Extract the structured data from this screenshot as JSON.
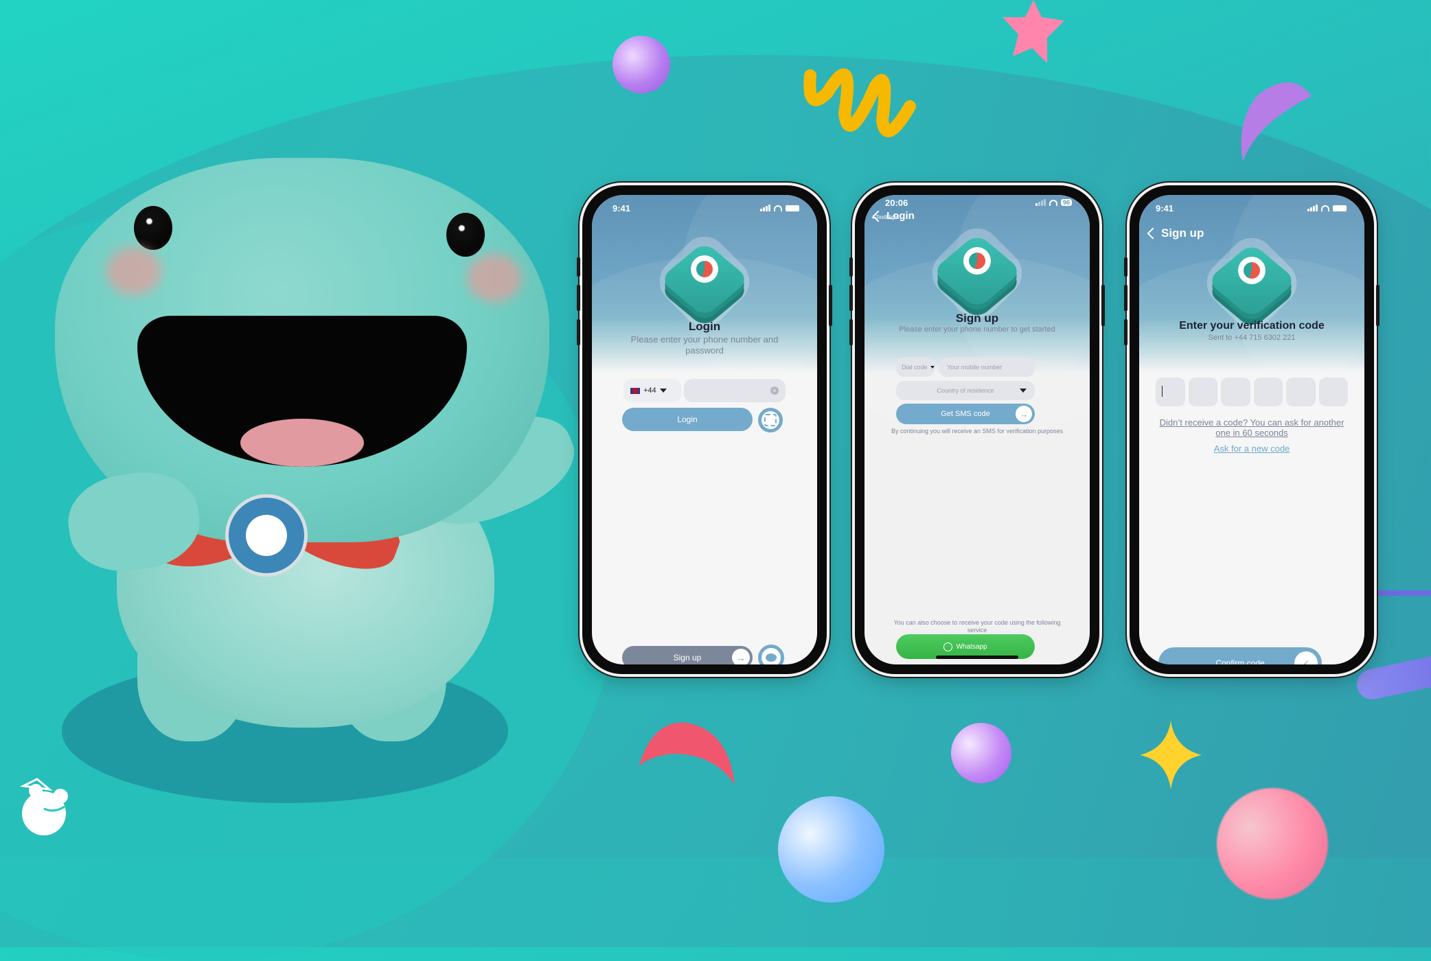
{
  "colors": {
    "background_teal": "#22d3c2",
    "primary_button": "#74aacb",
    "secondary_button": "#7d879b",
    "whatsapp_green": "#3ec24d",
    "text_dark": "#1c2333",
    "text_muted": "#7c8498",
    "link_blue": "#6fa8c9"
  },
  "brand": {
    "logo_icon": "mother-child-logo-icon"
  },
  "mascot": {
    "description": "frog mascot with red scarf and badge"
  },
  "phones": [
    {
      "status": {
        "time": "9:41"
      },
      "title": "Login",
      "subtitle": "Please enter your phone number and password",
      "country_flag": "uk-flag-icon",
      "dial_code": "+44",
      "phone_value": "",
      "login_label": "Login",
      "faceid_icon": "face-id-icon",
      "signup_label": "Sign up",
      "chat_icon": "chat-bubble-icon"
    },
    {
      "status": {
        "time": "20:06",
        "back_app": "TestFlight",
        "battery": "96"
      },
      "back_label": "Login",
      "title": "Sign up",
      "subtitle": "Please enter your phone number to get started",
      "dial_placeholder": "Dial code",
      "mobile_placeholder": "Your mobile number",
      "country_placeholder": "Country of residence",
      "sms_label": "Get SMS code",
      "sms_note": "By continuing you will receive an SMS for verification purposes",
      "alt_note": "You can also choose to receive your code using the following service",
      "whatsapp_label": "Whatsapp"
    },
    {
      "status": {
        "time": "9:41"
      },
      "back_label": "Sign up",
      "title": "Enter your verification code",
      "subtitle": "Sent to +44 715 6302 221",
      "code_digits": [
        "",
        "",
        "",
        "",
        "",
        ""
      ],
      "resend_note": "Didn’t receive a code? You can ask for another one in 60 seconds",
      "new_code_link": "Ask for a new code",
      "confirm_label": "Confirm code"
    }
  ]
}
